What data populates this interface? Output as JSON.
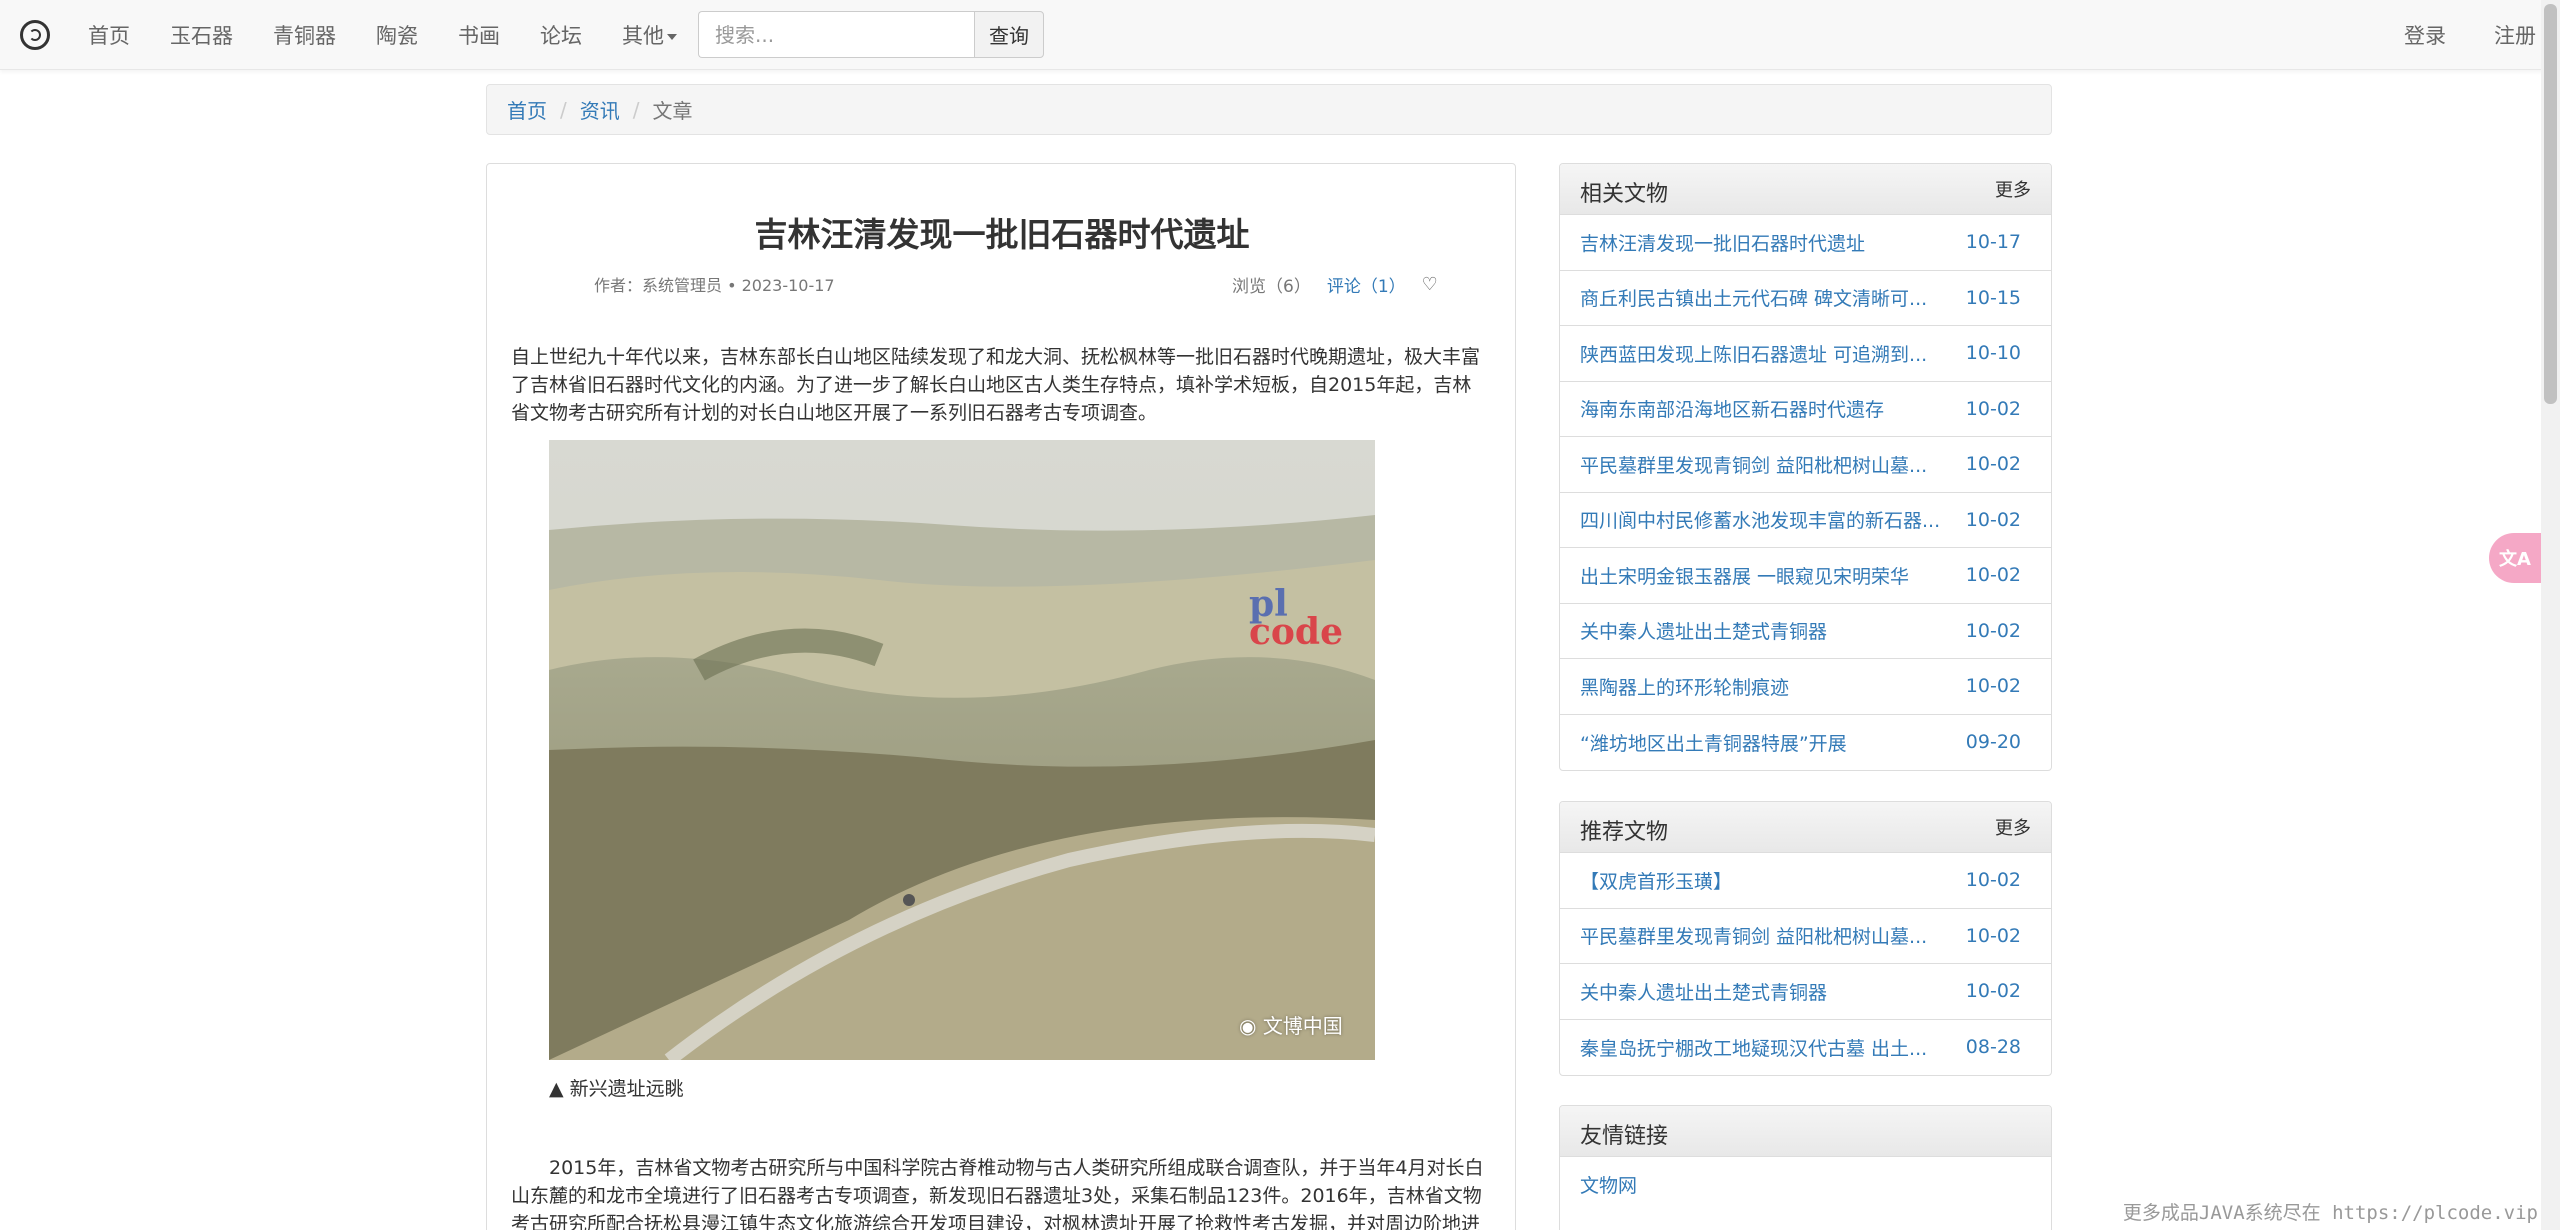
{
  "navbar": {
    "items": [
      {
        "label": "首页"
      },
      {
        "label": "玉石器"
      },
      {
        "label": "青铜器"
      },
      {
        "label": "陶瓷"
      },
      {
        "label": "书画"
      },
      {
        "label": "论坛"
      },
      {
        "label": "其他"
      }
    ],
    "search_placeholder": "搜索...",
    "search_button": "查询",
    "login": "登录",
    "register": "注册"
  },
  "breadcrumb": {
    "home": "首页",
    "news": "资讯",
    "current": "文章"
  },
  "article": {
    "title": "吉林汪清发现一批旧石器时代遗址",
    "author": "作者：系统管理员 • 2023-10-17",
    "views": "浏览（6）",
    "comments": "评论（1）",
    "para1": "自上世纪九十年代以来，吉林东部长白山地区陆续发现了和龙大洞、抚松枫林等一批旧石器时代晚期遗址，极大丰富了吉林省旧石器时代文化的内涵。为了进一步了解长白山地区古人类生存特点，填补学术短板，自2015年起，吉林省文物考古研究所有计划的对长白山地区开展了一系列旧石器考古专项调查。",
    "photo_watermark": "文博中国",
    "photo_logo_top": "pl",
    "photo_logo_bottom": "code",
    "caption": "▲ 新兴遗址远眺",
    "para2": "2015年，吉林省文物考古研究所与中国科学院古脊椎动物与古人类研究所组成联合调查队，并于当年4月对长白山东麓的和龙市全境进行了旧石器考古专项调查，新发现旧石器遗址3处，采集石制品123件。2016年，吉林省文物考古研究所配合抚松县漫江镇生态文化旅游综合开发项目建设，对枫林遗址开展了抢救性考古发掘，并对周边阶地进"
  },
  "related": {
    "title": "相关文物",
    "more": "更多",
    "items": [
      {
        "title": "吉林汪清发现一批旧石器时代遗址",
        "date": "10-17"
      },
      {
        "title": "商丘利民古镇出土元代石碑 碑文清晰可...",
        "date": "10-15"
      },
      {
        "title": "陕西蓝田发现上陈旧石器遗址 可追溯到...",
        "date": "10-10"
      },
      {
        "title": "海南东南部沿海地区新石器时代遗存",
        "date": "10-02"
      },
      {
        "title": "平民墓群里发现青铜剑 益阳枇杷树山墓...",
        "date": "10-02"
      },
      {
        "title": "四川阆中村民修蓄水池发现丰富的新石器...",
        "date": "10-02"
      },
      {
        "title": "出土宋明金银玉器展 一眼窥见宋明荣华",
        "date": "10-02"
      },
      {
        "title": "关中秦人遗址出土楚式青铜器",
        "date": "10-02"
      },
      {
        "title": "黑陶器上的环形轮制痕迹",
        "date": "10-02"
      },
      {
        "title": "“潍坊地区出土青铜器特展”开展",
        "date": "09-20"
      }
    ]
  },
  "recommended": {
    "title": "推荐文物",
    "more": "更多",
    "items": [
      {
        "title": "【双虎首形玉璜】",
        "date": "10-02"
      },
      {
        "title": "平民墓群里发现青铜剑 益阳枇杷树山墓...",
        "date": "10-02"
      },
      {
        "title": "关中秦人遗址出土楚式青铜器",
        "date": "10-02"
      },
      {
        "title": "秦皇岛抚宁棚改工地疑现汉代古墓 出土...",
        "date": "08-28"
      }
    ]
  },
  "links": {
    "title": "友情链接",
    "items": [
      {
        "title": "文物网"
      }
    ]
  },
  "translate_label": "文A",
  "footer_note": "更多成品JAVA系统尽在 https://plcode.vip"
}
